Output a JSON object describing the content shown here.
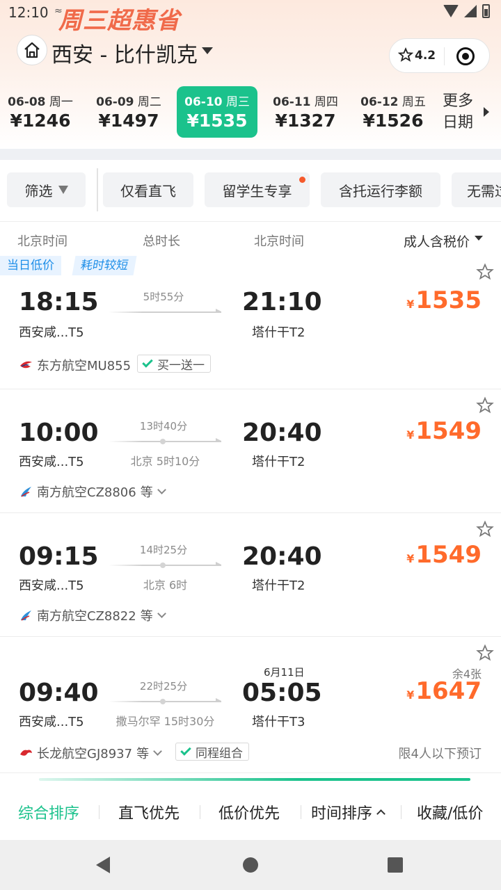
{
  "status": {
    "time": "12:10",
    "mini": "≈",
    "promo": "周三超惠省"
  },
  "header": {
    "route": "西安 - 比什凯克",
    "rating": "4.2",
    "icons": [
      "home-icon",
      "star-icon",
      "record-icon"
    ]
  },
  "dates": [
    {
      "date": "06-08",
      "weekday": "周一",
      "price": "¥1246",
      "selected": false
    },
    {
      "date": "06-09",
      "weekday": "周二",
      "price": "¥1497",
      "selected": false
    },
    {
      "date": "06-10",
      "weekday": "周三",
      "price": "¥1535",
      "selected": true
    },
    {
      "date": "06-11",
      "weekday": "周四",
      "price": "¥1327",
      "selected": false
    },
    {
      "date": "06-12",
      "weekday": "周五",
      "price": "¥1526",
      "selected": false
    }
  ],
  "more_dates": [
    "更多",
    "日期"
  ],
  "filters": [
    "筛选",
    "仅看直飞",
    "留学生专享",
    "含托运行李额",
    "无需过"
  ],
  "columns": {
    "dep": "北京时间",
    "dur": "总时长",
    "arr": "北京时间",
    "price": "成人含税价"
  },
  "flights": [
    {
      "tags": [
        "当日低价",
        "耗时较短"
      ],
      "dep_time": "18:15",
      "dep_airport": "西安咸...T5",
      "duration": "5时55分",
      "stop": "",
      "arr_time": "21:10",
      "arr_airport": "塔什干T2",
      "next_day": "",
      "currency": "¥",
      "price": "1535",
      "remain": "",
      "airline": "东方航空MU855",
      "airline_suffix": "",
      "badge": "买一送一",
      "limit": ""
    },
    {
      "tags": [],
      "dep_time": "10:00",
      "dep_airport": "西安咸...T5",
      "duration": "13时40分",
      "stop": "北京  5时10分",
      "arr_time": "20:40",
      "arr_airport": "塔什干T2",
      "next_day": "",
      "currency": "¥",
      "price": "1549",
      "remain": "",
      "airline": "南方航空CZ8806",
      "airline_suffix": "等",
      "badge": "",
      "limit": ""
    },
    {
      "tags": [],
      "dep_time": "09:15",
      "dep_airport": "西安咸...T5",
      "duration": "14时25分",
      "stop": "北京  6时",
      "arr_time": "20:40",
      "arr_airport": "塔什干T2",
      "next_day": "",
      "currency": "¥",
      "price": "1549",
      "remain": "",
      "airline": "南方航空CZ8822",
      "airline_suffix": "等",
      "badge": "",
      "limit": ""
    },
    {
      "tags": [],
      "dep_time": "09:40",
      "dep_airport": "西安咸...T5",
      "duration": "22时25分",
      "stop": "撒马尔罕  15时30分",
      "arr_time": "05:05",
      "arr_airport": "塔什干T3",
      "next_day": "6月11日",
      "currency": "¥",
      "price": "1647",
      "remain": "余4张",
      "airline": "长龙航空GJ8937",
      "airline_suffix": "等",
      "badge": "同程组合",
      "limit": "限4人以下预订"
    }
  ],
  "sort_tabs": [
    "综合排序",
    "直飞优先",
    "低价优先",
    "时间排序",
    "收藏/低价"
  ],
  "colors": {
    "accent": "#1bc28c",
    "price": "#ff6a2b",
    "tag": "#1f8fe8",
    "promo": "#f06a4a"
  }
}
